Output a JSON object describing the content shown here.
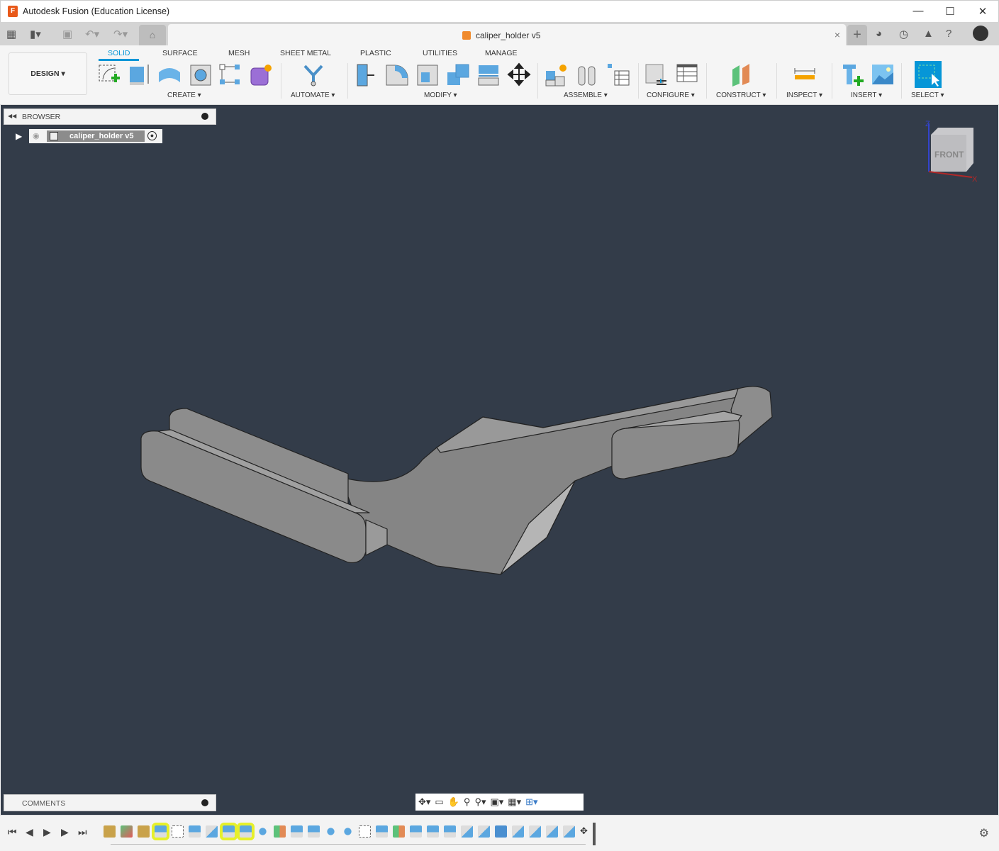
{
  "window": {
    "title": "Autodesk Fusion (Education License)",
    "app_icon": "F",
    "controls": [
      "minimize",
      "maximize",
      "close"
    ]
  },
  "tabs": {
    "document": "caliper_holder v5",
    "icons": [
      "grid-icon",
      "file-icon",
      "save-icon",
      "undo-icon",
      "redo-icon",
      "home-icon"
    ],
    "right_icons": [
      "plus-icon",
      "extensions-icon",
      "job-status-icon",
      "notifications-icon",
      "help-icon",
      "avatar"
    ]
  },
  "ribbon": {
    "workspace": "DESIGN",
    "tabs": [
      {
        "label": "SOLID",
        "active": true
      },
      {
        "label": "SURFACE"
      },
      {
        "label": "MESH"
      },
      {
        "label": "SHEET METAL"
      },
      {
        "label": "PLASTIC"
      },
      {
        "label": "UTILITIES"
      },
      {
        "label": "MANAGE"
      }
    ],
    "groups": [
      "CREATE",
      "AUTOMATE",
      "MODIFY",
      "ASSEMBLE",
      "CONFIGURE",
      "CONSTRUCT",
      "INSPECT",
      "INSERT",
      "SELECT"
    ],
    "accent": "#0696d7"
  },
  "browser": {
    "title": "BROWSER",
    "root": "caliper_holder v5"
  },
  "comments": {
    "label": "COMMENTS"
  },
  "viewcube": {
    "face": "FRONT",
    "axes": [
      "Z",
      "X"
    ]
  },
  "navbar": {
    "icons": [
      "orbit-icon",
      "look-at-icon",
      "pan-icon",
      "zoom-icon",
      "fit-icon",
      "display-settings-icon",
      "grid-settings-icon",
      "viewports-icon"
    ]
  },
  "timeline": {
    "controls": [
      "first",
      "previous",
      "play",
      "next",
      "last"
    ],
    "features": [
      "component",
      "body",
      "joint",
      "extrude",
      "sketch",
      "extrude",
      "fillet",
      "extrude",
      "extrude",
      "hole",
      "plane",
      "extrude",
      "extrude",
      "hole",
      "hole",
      "sketch",
      "extrude",
      "plane",
      "extrude",
      "extrude",
      "extrude",
      "fillet",
      "fillet",
      "combine",
      "fillet",
      "fillet",
      "fillet",
      "fillet",
      "move"
    ],
    "highlighted": [
      3,
      7,
      8
    ],
    "highlight_color": "#e6f02a"
  },
  "colors": {
    "viewport": "#333c49",
    "body": "#8a8a8a"
  }
}
